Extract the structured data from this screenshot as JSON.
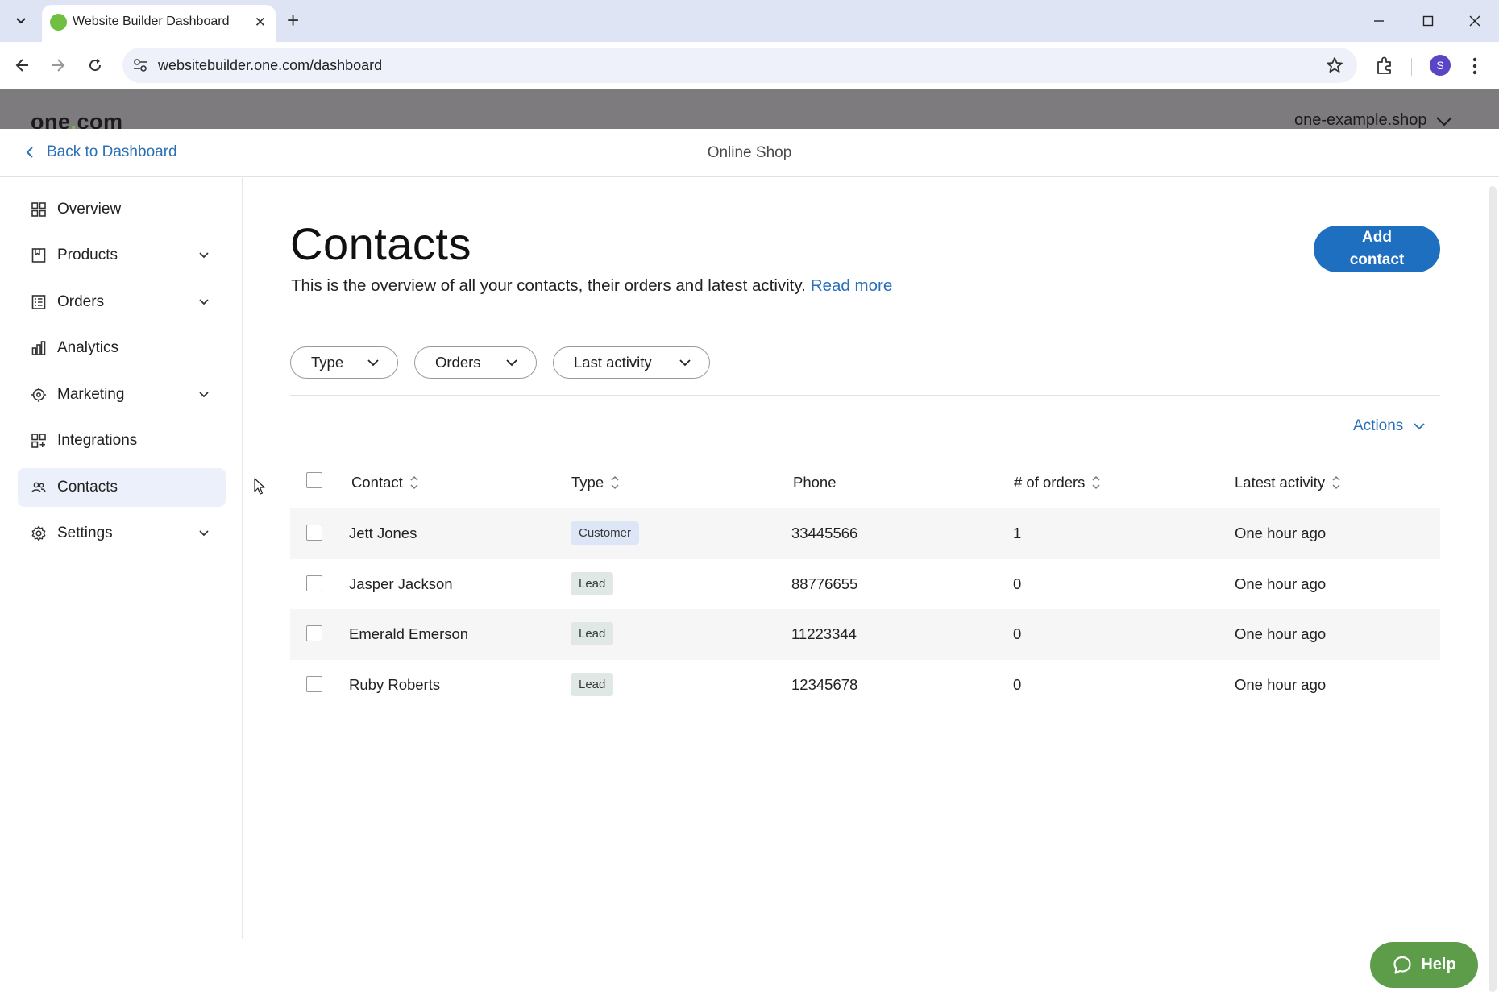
{
  "browser": {
    "tab_title": "Website Builder Dashboard",
    "url": "websitebuilder.one.com/dashboard",
    "profile_initial": "S",
    "favicon_color": "#6fbf40"
  },
  "header": {
    "brand_left": "one",
    "brand_dot": ".",
    "brand_right": "com",
    "domain": "one-example.shop"
  },
  "subheader": {
    "back_label": "Back to Dashboard",
    "title": "Online Shop"
  },
  "sidebar": {
    "items": [
      {
        "label": "Overview",
        "icon": "grid-icon"
      },
      {
        "label": "Products",
        "icon": "box-icon"
      },
      {
        "label": "Orders",
        "icon": "list-icon"
      },
      {
        "label": "Analytics",
        "icon": "bar-chart-icon"
      },
      {
        "label": "Marketing",
        "icon": "target-icon"
      },
      {
        "label": "Integrations",
        "icon": "grid-plus-icon"
      },
      {
        "label": "Contacts",
        "icon": "people-icon"
      },
      {
        "label": "Settings",
        "icon": "gear-icon"
      }
    ],
    "active": "Contacts"
  },
  "main": {
    "title": "Contacts",
    "description": "This is the overview of all your contacts, their orders and latest activity.",
    "read_more": "Read more",
    "add_button": "Add contact",
    "filters": [
      "Type",
      "Orders",
      "Last activity"
    ],
    "actions_label": "Actions",
    "table": {
      "columns": [
        "Contact",
        "Type",
        "Phone",
        "# of orders",
        "Latest activity"
      ],
      "rows": [
        {
          "contact": "Jett Jones",
          "type": "Customer",
          "phone": "33445566",
          "orders": "1",
          "activity": "One hour ago"
        },
        {
          "contact": "Jasper Jackson",
          "type": "Lead",
          "phone": "88776655",
          "orders": "0",
          "activity": "One hour ago"
        },
        {
          "contact": "Emerald Emerson",
          "type": "Lead",
          "phone": "11223344",
          "orders": "0",
          "activity": "One hour ago"
        },
        {
          "contact": "Ruby Roberts",
          "type": "Lead",
          "phone": "12345678",
          "orders": "0",
          "activity": "One hour ago"
        }
      ]
    }
  },
  "help": {
    "label": "Help"
  },
  "colors": {
    "link": "#2a70b8",
    "primary_button": "#1f6fc0",
    "help_button": "#5d9d49",
    "header_bg": "#7e7b7e",
    "active_nav_bg": "#ecf0fa"
  }
}
